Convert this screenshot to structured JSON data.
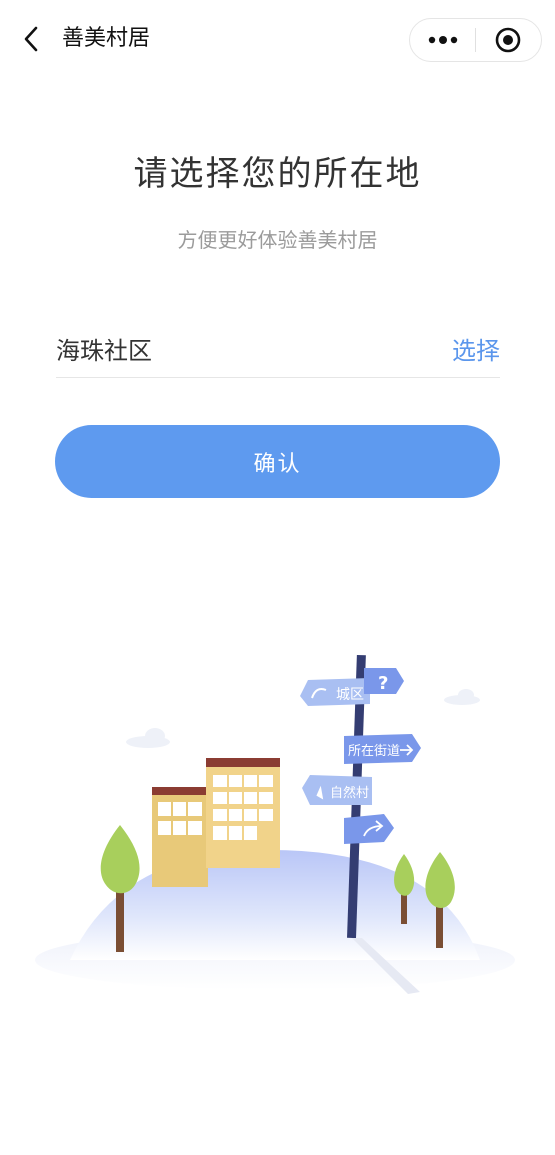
{
  "navbar": {
    "title": "善美村居",
    "back_icon": "chevron-left-icon",
    "more_icon": "more-dots-icon",
    "close_icon": "target-circle-icon"
  },
  "main": {
    "title": "请选择您的所在地",
    "subtitle": "方便更好体验善美村居",
    "location": {
      "value": "海珠社区",
      "select_label": "选择"
    },
    "confirm_label": "确认"
  },
  "illustration": {
    "signs": [
      "城区",
      "?",
      "所在街道",
      "自然村"
    ]
  },
  "colors": {
    "accent": "#5e9aef",
    "link": "#5b96ec"
  }
}
